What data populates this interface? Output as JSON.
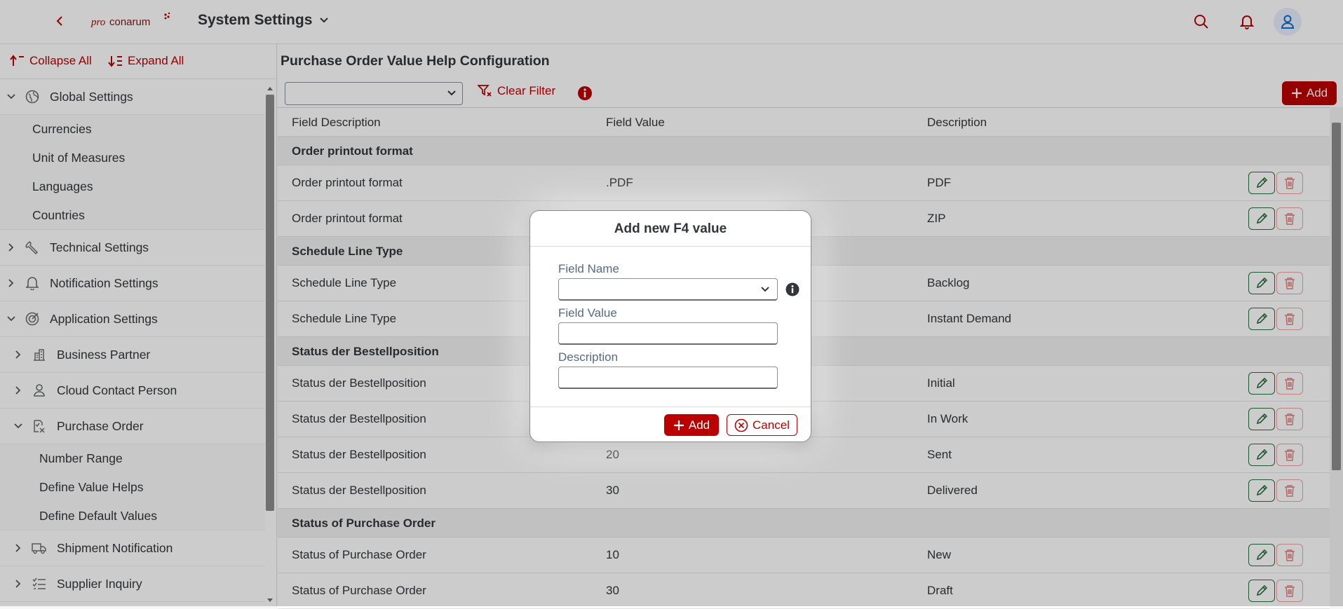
{
  "shell": {
    "logo_text_left": "pro",
    "logo_text_right": "conarum",
    "title": "System Settings"
  },
  "sidebar": {
    "collapse_all": "Collapse All",
    "expand_all": "Expand All",
    "items": [
      {
        "label": "Global Settings",
        "icon": "globe-icon",
        "expanded": true
      },
      {
        "label": "Currencies"
      },
      {
        "label": "Unit of Measures"
      },
      {
        "label": "Languages"
      },
      {
        "label": "Countries"
      },
      {
        "label": "Technical Settings",
        "icon": "wrench-icon",
        "expanded": false
      },
      {
        "label": "Notification Settings",
        "icon": "bell-icon",
        "expanded": false
      },
      {
        "label": "Application Settings",
        "icon": "target-icon",
        "expanded": true
      },
      {
        "label": "Business Partner",
        "icon": "building-icon",
        "expanded": false
      },
      {
        "label": "Cloud Contact Person",
        "icon": "person-icon",
        "expanded": false
      },
      {
        "label": "Purchase Order",
        "icon": "document-icon",
        "expanded": true
      },
      {
        "label": "Number Range"
      },
      {
        "label": "Define Value Helps"
      },
      {
        "label": "Define Default Values"
      },
      {
        "label": "Shipment Notification",
        "icon": "truck-icon",
        "expanded": false
      },
      {
        "label": "Supplier Inquiry",
        "icon": "checklist-icon",
        "expanded": false
      }
    ]
  },
  "main": {
    "title": "Purchase Order Value Help Configuration",
    "filter_value": "",
    "clear_filter": "Clear Filter",
    "add_label": "Add",
    "columns": [
      "Field Description",
      "Field Value",
      "Description"
    ],
    "groups": [
      {
        "title": "Order printout format",
        "rows": [
          {
            "field_description": "Order printout format",
            "field_value": ".PDF",
            "description": "PDF"
          },
          {
            "field_description": "Order printout format",
            "field_value": "",
            "description": "ZIP"
          }
        ]
      },
      {
        "title": "Schedule Line Type",
        "rows": [
          {
            "field_description": "Schedule Line Type",
            "field_value": "",
            "description": "Backlog"
          },
          {
            "field_description": "Schedule Line Type",
            "field_value": "",
            "description": "Instant Demand"
          }
        ]
      },
      {
        "title": "Status der Bestellposition",
        "rows": [
          {
            "field_description": "Status der Bestellposition",
            "field_value": "",
            "description": "Initial"
          },
          {
            "field_description": "Status der Bestellposition",
            "field_value": "",
            "description": "In Work"
          },
          {
            "field_description": "Status der Bestellposition",
            "field_value": "20",
            "description": "Sent"
          },
          {
            "field_description": "Status der Bestellposition",
            "field_value": "30",
            "description": "Delivered"
          }
        ]
      },
      {
        "title": "Status of Purchase Order",
        "rows": [
          {
            "field_description": "Status of Purchase Order",
            "field_value": "10",
            "description": "New"
          },
          {
            "field_description": "Status of Purchase Order",
            "field_value": "30",
            "description": "Draft"
          }
        ]
      }
    ]
  },
  "dialog": {
    "title": "Add new F4 value",
    "field_name_label": "Field Name",
    "field_name_value": "",
    "field_value_label": "Field Value",
    "field_value_value": "",
    "description_label": "Description",
    "description_value": "",
    "add_label": "Add",
    "cancel_label": "Cancel"
  },
  "colors": {
    "accent": "#bb0000",
    "edit_green": "#256f3a",
    "group_bg": "#f2f2f2"
  }
}
